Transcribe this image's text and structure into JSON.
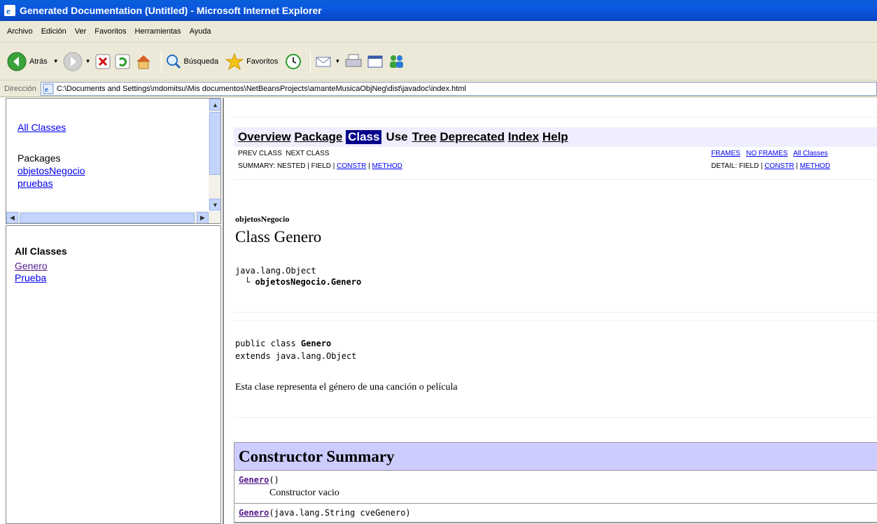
{
  "window": {
    "title": "Generated Documentation (Untitled) - Microsoft Internet Explorer"
  },
  "menu": [
    "Archivo",
    "Edición",
    "Ver",
    "Favoritos",
    "Herramientas",
    "Ayuda"
  ],
  "toolbar": {
    "back": "Atrás",
    "search": "Búsqueda",
    "favorites": "Favoritos"
  },
  "address": {
    "label": "Dirección",
    "url": "C:\\Documents and Settings\\mdomitsu\\Mis documentos\\NetBeansProjects\\amanteMusicaObjNeg\\dist\\javadoc\\index.html"
  },
  "left_top": {
    "all_classes": "All Classes",
    "packages_heading": "Packages",
    "packages": [
      "objetosNegocio",
      "pruebas"
    ]
  },
  "left_bottom": {
    "heading": "All Classes",
    "classes": [
      "Genero",
      "Prueba"
    ]
  },
  "main": {
    "nav": [
      "Overview",
      "Package",
      "Class",
      "Use",
      "Tree",
      "Deprecated",
      "Index",
      "Help"
    ],
    "prev_class": "PREV CLASS",
    "next_class": "NEXT CLASS",
    "frames": "FRAMES",
    "no_frames": "NO FRAMES",
    "all_classes": "All Classes",
    "summary_prefix": "SUMMARY: NESTED | FIELD | ",
    "detail_prefix": "DETAIL: FIELD | ",
    "constr": "CONSTR",
    "method": "METHOD",
    "sep": " | ",
    "package_name": "objetosNegocio",
    "class_title": "Class Genero",
    "inherit_root": "java.lang.Object",
    "inherit_child": "objetosNegocio.Genero",
    "decl_line1_prefix": "public class ",
    "decl_class": "Genero",
    "decl_line2": "extends java.lang.Object",
    "description": "Esta clase representa el género de una canción o película",
    "constructor_summary": "Constructor Summary",
    "constructors": [
      {
        "name": "Genero",
        "args": "()",
        "desc": "Constructor vacio"
      },
      {
        "name": "Genero",
        "args": "(java.lang.String cveGenero)",
        "desc": ""
      }
    ]
  }
}
